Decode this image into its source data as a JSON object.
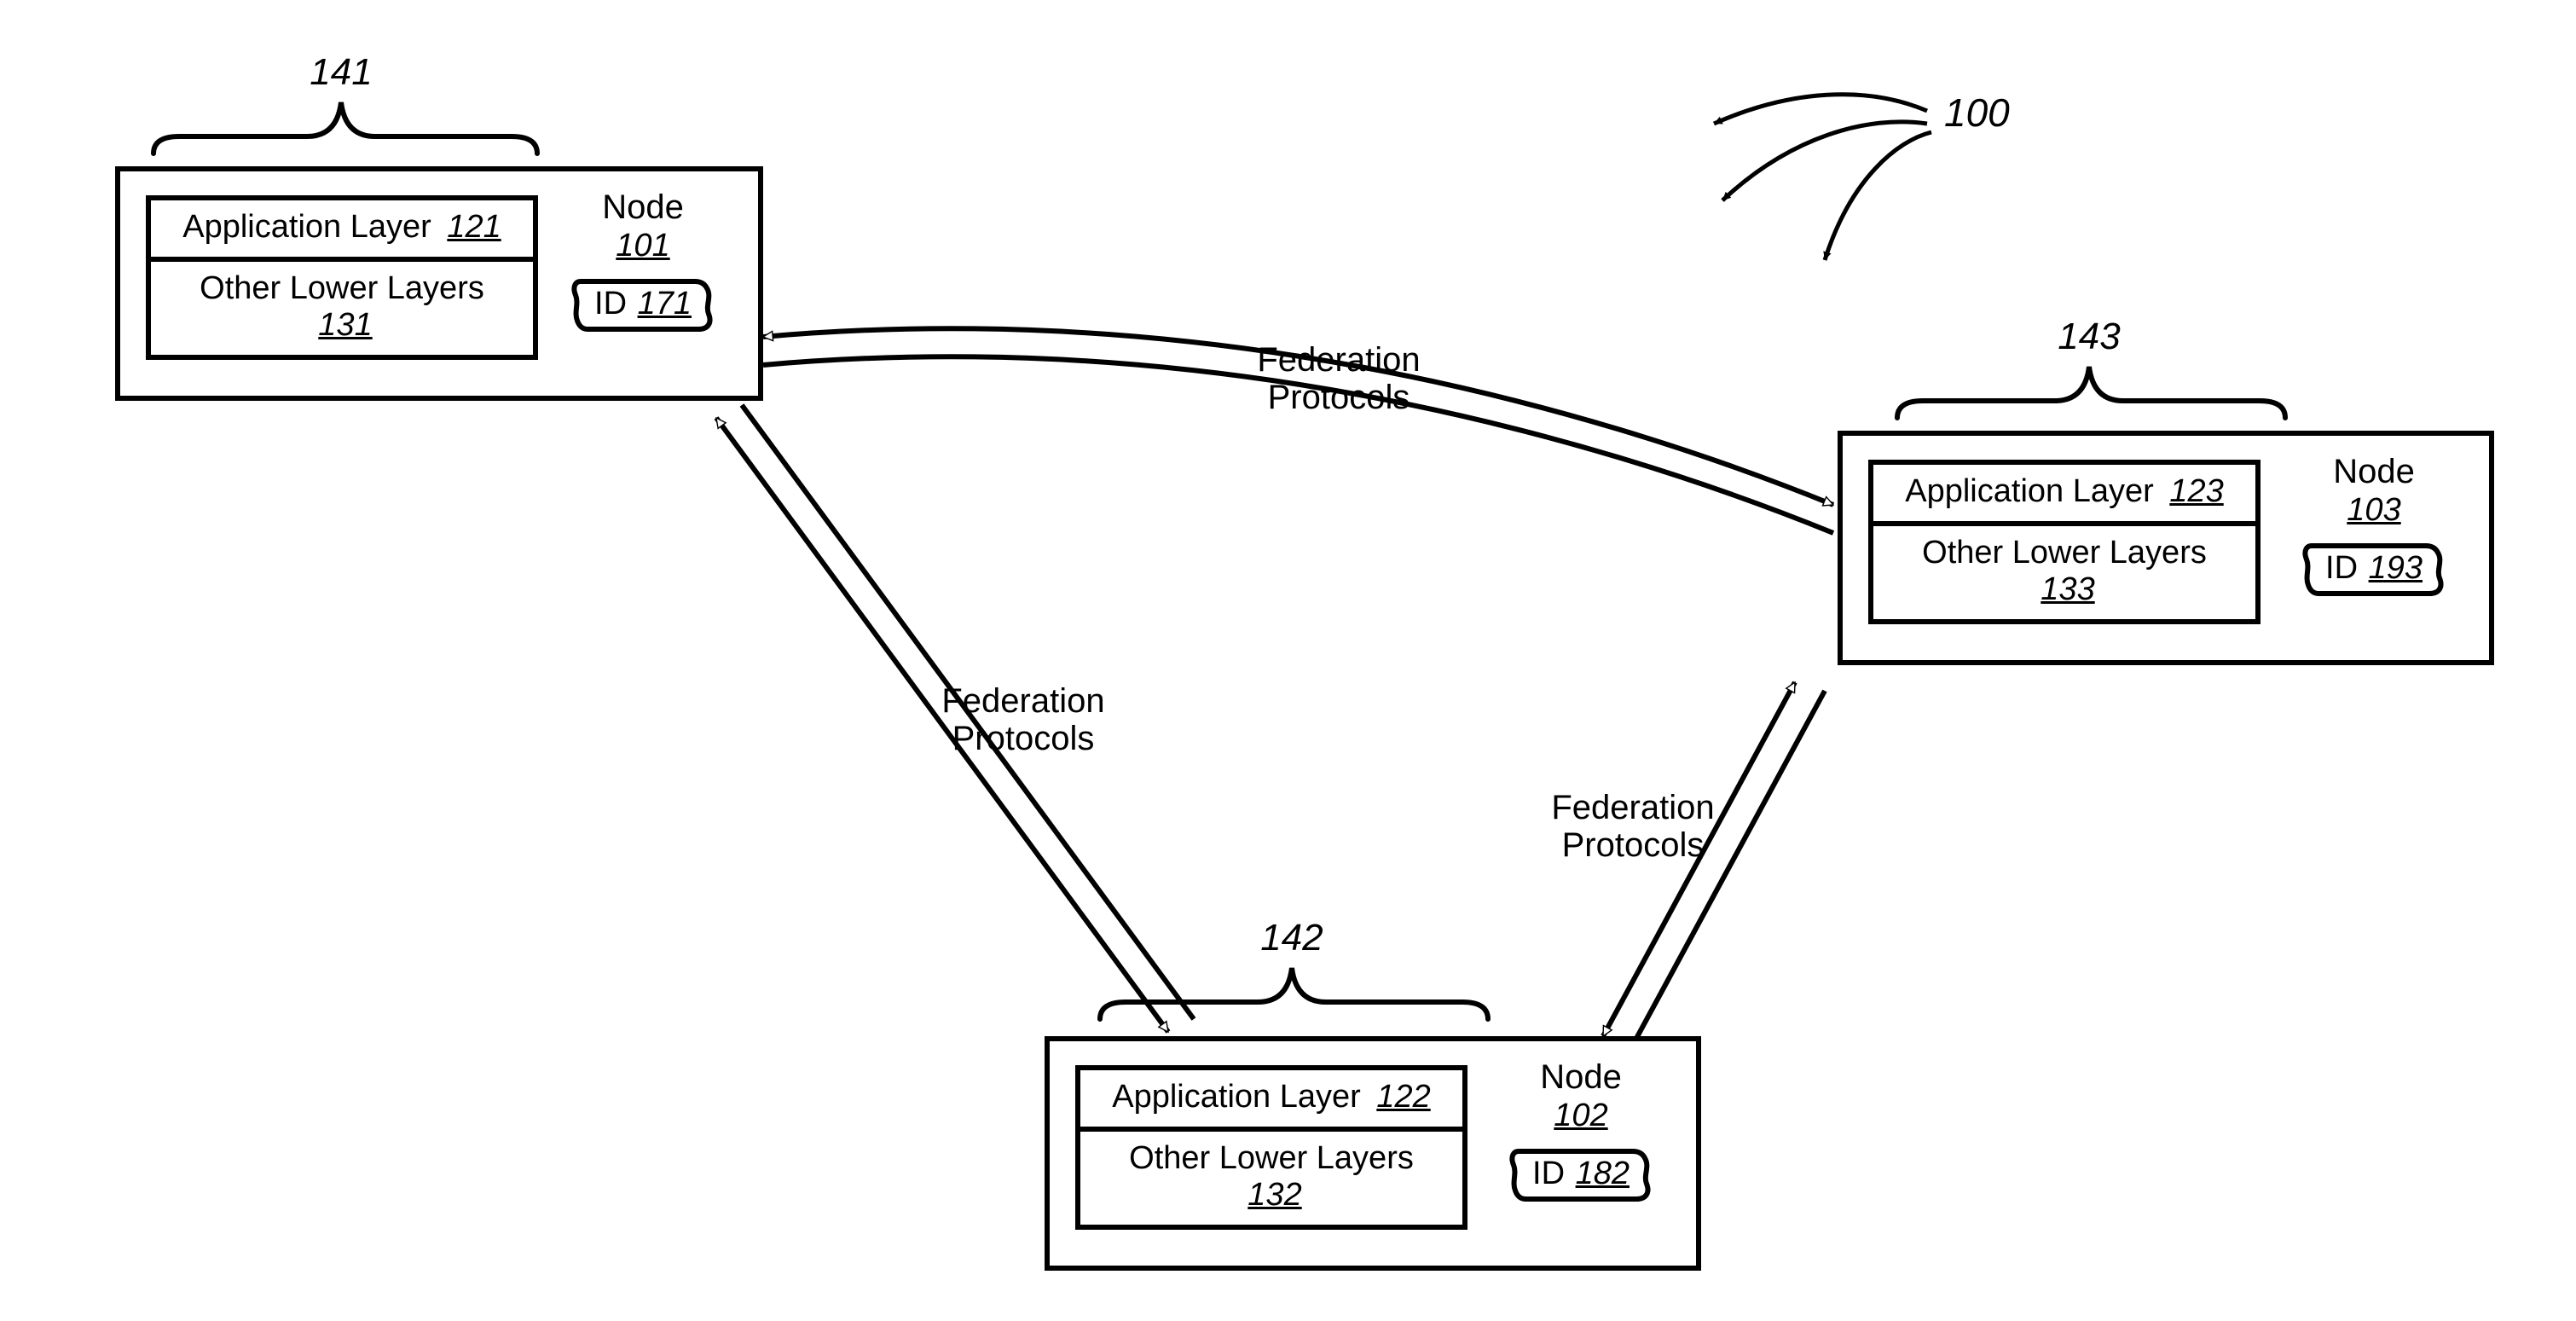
{
  "figure_ref": "100",
  "labels": {
    "node_word": "Node",
    "id_prefix": "ID",
    "app_layer": "Application Layer",
    "other_lower": "Other Lower Layers",
    "federation_line1": "Federation",
    "federation_line2": "Protocols"
  },
  "nodes": {
    "n1": {
      "brace_num": "141",
      "app_num": "121",
      "ol_num": "131",
      "node_num": "101",
      "id_num": "171"
    },
    "n2": {
      "brace_num": "142",
      "app_num": "122",
      "ol_num": "132",
      "node_num": "102",
      "id_num": "182"
    },
    "n3": {
      "brace_num": "143",
      "app_num": "123",
      "ol_num": "133",
      "node_num": "103",
      "id_num": "193"
    }
  }
}
